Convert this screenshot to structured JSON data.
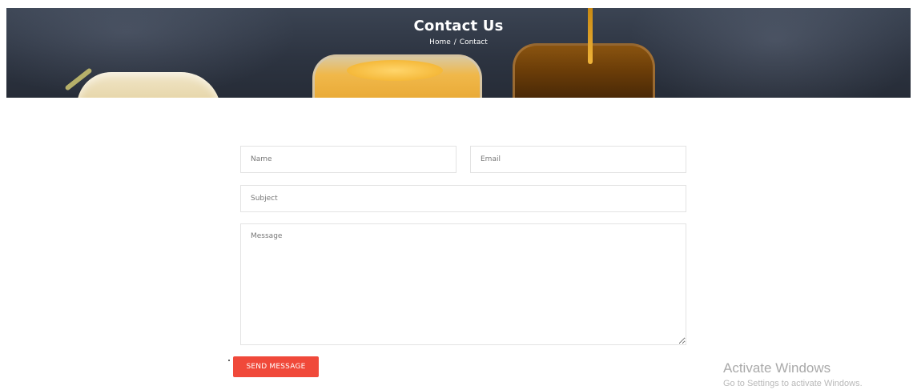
{
  "hero": {
    "title": "Contact Us",
    "breadcrumb": {
      "home": "Home",
      "separator": "/",
      "current": "Contact"
    }
  },
  "form": {
    "name_placeholder": "Name",
    "email_placeholder": "Email",
    "subject_placeholder": "Subject",
    "message_placeholder": "Message",
    "submit_label": "SEND MESSAGE"
  },
  "watermark": {
    "title": "Activate Windows",
    "subtitle": "Go to Settings to activate Windows."
  },
  "colors": {
    "accent": "#f0493a",
    "banner": "#2f3642"
  }
}
